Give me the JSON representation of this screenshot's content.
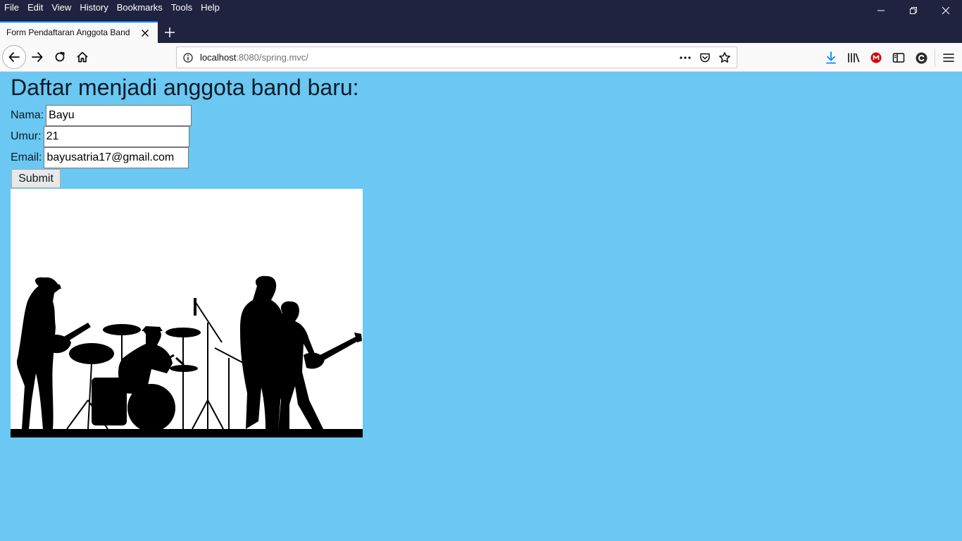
{
  "menubar": {
    "items": [
      "File",
      "Edit",
      "View",
      "History",
      "Bookmarks",
      "Tools",
      "Help"
    ]
  },
  "tab": {
    "title": "Form Pendaftaran Anggota Band"
  },
  "urlbar": {
    "host": "localhost",
    "path": ":8080/spring.mvc/"
  },
  "page": {
    "title": "Daftar menjadi anggota band baru:",
    "form": {
      "nama_label": "Nama:",
      "nama_value": "Bayu",
      "umur_label": "Umur:",
      "umur_value": "21",
      "email_label": "Email:",
      "email_value": "bayusatria17@gmail.com",
      "submit_label": "Submit"
    }
  },
  "icons": {
    "menubar": [
      "minimize-icon",
      "restore-icon",
      "close-icon"
    ],
    "navbar": [
      "back-icon",
      "forward-icon",
      "reload-icon",
      "home-icon",
      "info-icon",
      "page-actions-icon",
      "pocket-icon",
      "bookmark-star-icon",
      "download-icon",
      "library-icon",
      "mega-extension-icon",
      "sidebar-icon",
      "extension-c-icon",
      "hamburger-menu-icon"
    ]
  },
  "colors": {
    "page_background": "#6ac8f2",
    "titlebar": "#202340",
    "tab_accent": "#0a84ff",
    "download_icon": "#0a84ff",
    "mega_icon": "#d90007"
  }
}
